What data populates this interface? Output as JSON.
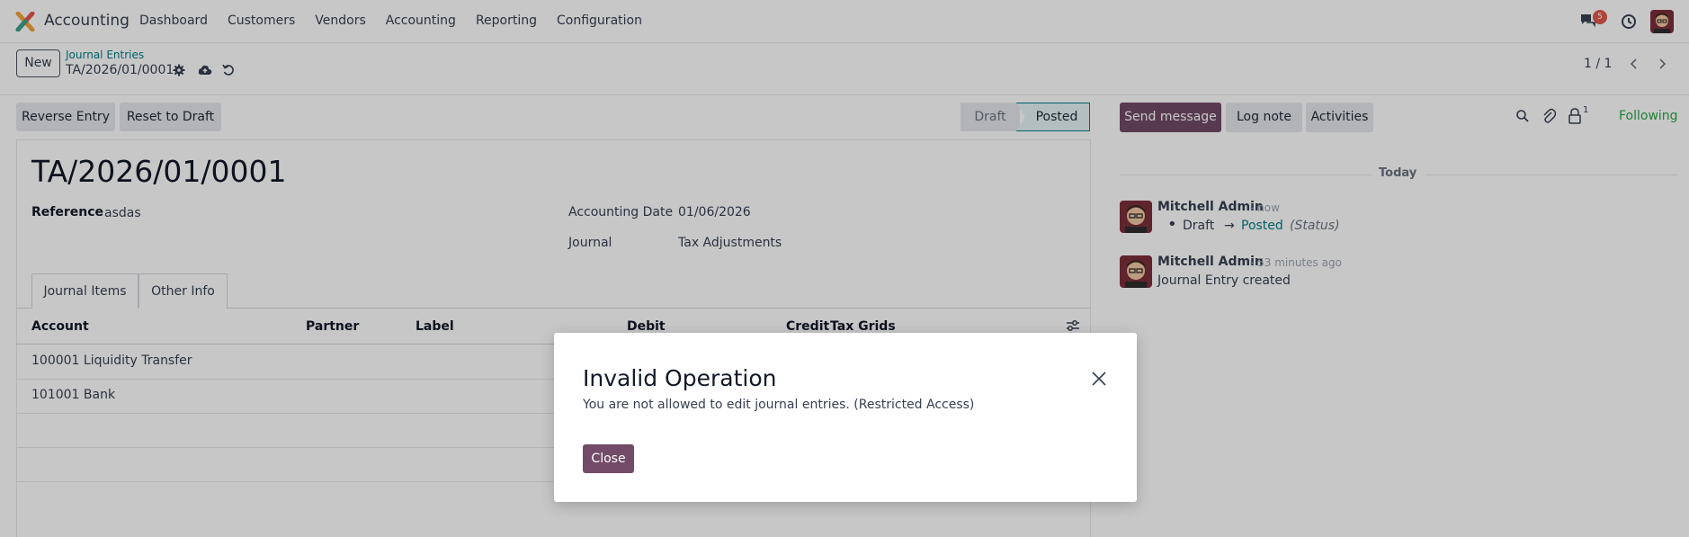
{
  "navbar": {
    "app_name": "Accounting",
    "menu": [
      "Dashboard",
      "Customers",
      "Vendors",
      "Accounting",
      "Reporting",
      "Configuration"
    ],
    "chat_badge": "5"
  },
  "control_panel": {
    "new_label": "New",
    "breadcrumb": "Journal Entries",
    "record_name": "TA/2026/01/0001",
    "pager": "1 / 1"
  },
  "form": {
    "buttons": {
      "reverse": "Reverse Entry",
      "reset": "Reset to Draft"
    },
    "status": {
      "draft": "Draft",
      "posted": "Posted"
    },
    "title": "TA/2026/01/0001",
    "reference_label": "Reference",
    "reference_value": "asdas",
    "accounting_date_label": "Accounting Date",
    "accounting_date_value": "01/06/2026",
    "journal_label": "Journal",
    "journal_value": "Tax Adjustments",
    "tabs": [
      "Journal Items",
      "Other Info"
    ],
    "columns": [
      "Account",
      "Partner",
      "Label",
      "Debit",
      "Credit",
      "Tax Grids"
    ],
    "rows": [
      {
        "account": "100001 Liquidity Transfer"
      },
      {
        "account": "101001 Bank"
      }
    ]
  },
  "chatter": {
    "send_message": "Send message",
    "log_note": "Log note",
    "activities": "Activities",
    "follower_count": "1",
    "following": "Following",
    "today": "Today",
    "messages": [
      {
        "author": "Mitchell Admin",
        "time": "- now",
        "from": "Draft",
        "arrow": "→",
        "to": "Posted",
        "field": "(Status)"
      },
      {
        "author": "Mitchell Admin",
        "time": "- 53 minutes ago",
        "body": "Journal Entry created"
      }
    ]
  },
  "modal": {
    "title": "Invalid Operation",
    "body": "You are not allowed to edit journal entries. (Restricted Access)",
    "close_label": "Close"
  },
  "colors": {
    "brand": "#714b67",
    "link": "#017e84",
    "following": "#28a745",
    "badge": "#e0584a"
  }
}
